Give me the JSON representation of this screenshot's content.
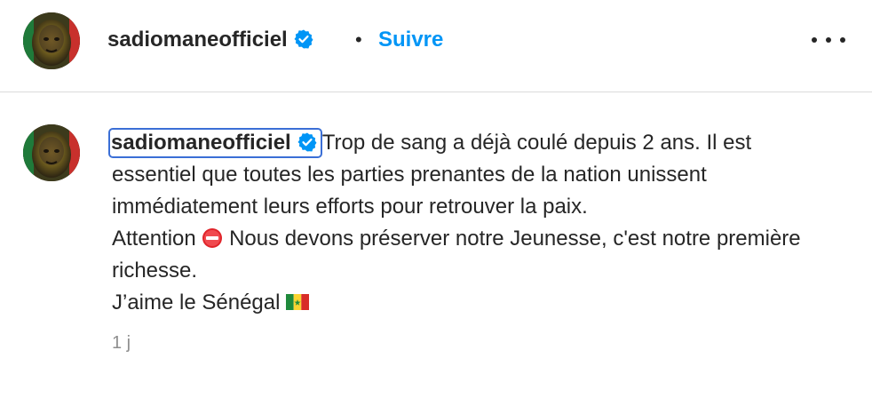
{
  "header": {
    "username": "sadiomaneofficiel",
    "separator": "•",
    "follow_label": "Suivre",
    "more_icon": "more-horizontal-icon"
  },
  "comment": {
    "username": "sadiomaneofficiel",
    "text_part1": "Trop de sang a déjà coulé depuis 2 ans. Il est essentiel que toutes les parties prenantes de la nation unissent immédiatement leurs efforts pour retrouver la paix.",
    "text_part2_before_icon": "Attention",
    "text_part2_after_icon": "Nous devons préserver notre Jeunesse, c'est notre première richesse.",
    "text_part3": "J’aime le Sénégal",
    "timestamp": "1 j"
  },
  "colors": {
    "follow_blue": "#0095f6",
    "verified_blue": "#0095f6",
    "divider": "#dbdbdb",
    "text_primary": "#262626",
    "text_secondary": "#8e8e8e"
  }
}
